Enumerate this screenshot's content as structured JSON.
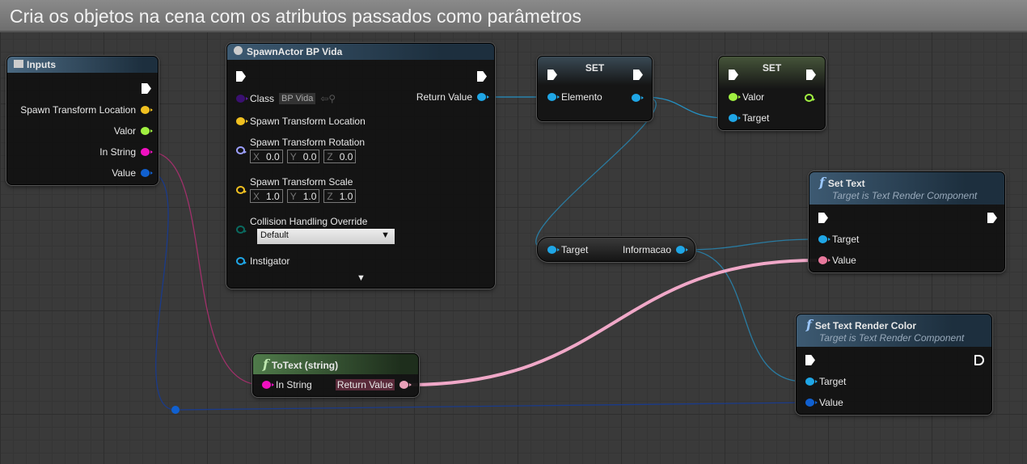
{
  "comment_title": "Cria os objetos na cena com os atributos passados como parâmetros",
  "colors": {
    "exec": "#ffffff",
    "object": "#1fa6e6",
    "vector": "#f0c020",
    "string": "#f010c0",
    "text": "#e8789c",
    "bool": "#a0f040",
    "linear_color": "#1060d0",
    "class": "#5a1aa0",
    "rotator": "#9da0ff",
    "enum": "#0a6a60"
  },
  "inputs": {
    "title": "Inputs",
    "pins": [
      "Spawn Transform Location",
      "Valor",
      "In String",
      "Value"
    ]
  },
  "spawn": {
    "title": "SpawnActor BP Vida",
    "class_label": "Class",
    "class_value": "BP Vida",
    "return_label": "Return Value",
    "loc": "Spawn Transform Location",
    "rot": "Spawn Transform Rotation",
    "rot_vals": [
      "0.0",
      "0.0",
      "0.0"
    ],
    "scale": "Spawn Transform Scale",
    "scale_vals": [
      "1.0",
      "1.0",
      "1.0"
    ],
    "axes": [
      "X",
      "Y",
      "Z"
    ],
    "collision": "Collision Handling Override",
    "collision_value": "Default",
    "instigator": "Instigator"
  },
  "set1": {
    "title": "SET",
    "pin": "Elemento"
  },
  "set2": {
    "title": "SET",
    "pin_valor": "Valor",
    "pin_target": "Target"
  },
  "get": {
    "target": "Target",
    "out": "Informacao"
  },
  "settext": {
    "title": "Set Text",
    "subtitle": "Target is Text Render Component",
    "target": "Target",
    "value": "Value"
  },
  "setcolor": {
    "title": "Set Text Render Color",
    "subtitle": "Target is Text Render Component",
    "target": "Target",
    "value": "Value"
  },
  "totext": {
    "title": "ToText (string)",
    "in": "In String",
    "out": "Return Value"
  }
}
